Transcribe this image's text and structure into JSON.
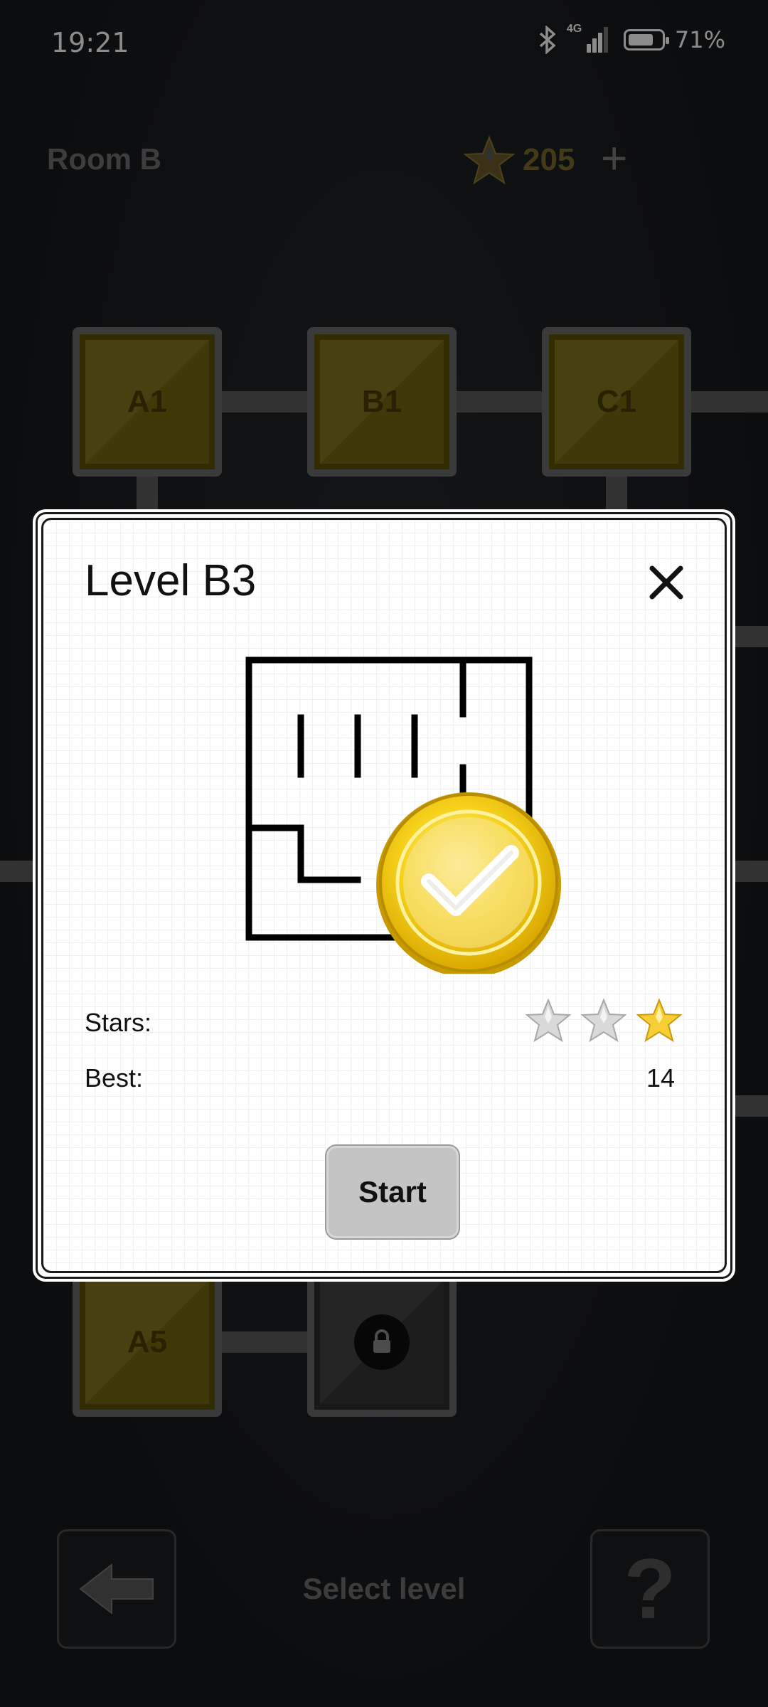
{
  "status_bar": {
    "time": "19:21",
    "network": "4G",
    "battery": "71%"
  },
  "header": {
    "room_title": "Room B",
    "star_total": "205",
    "add_label": "+"
  },
  "levels": {
    "a1": "A1",
    "b1": "B1",
    "c1": "C1",
    "a5": "A5"
  },
  "footer": {
    "select_level": "Select level",
    "help_label": "?"
  },
  "dialog": {
    "title": "Level B3",
    "stars_label": "Stars:",
    "best_label": "Best:",
    "best_value": "14",
    "stars_earned": 1,
    "stars_max": 3,
    "start_label": "Start",
    "completed": true
  },
  "colors": {
    "gold": "#f3cf16",
    "tile_gold": "#7d6f19",
    "dialog_bg": "#ffffff"
  }
}
